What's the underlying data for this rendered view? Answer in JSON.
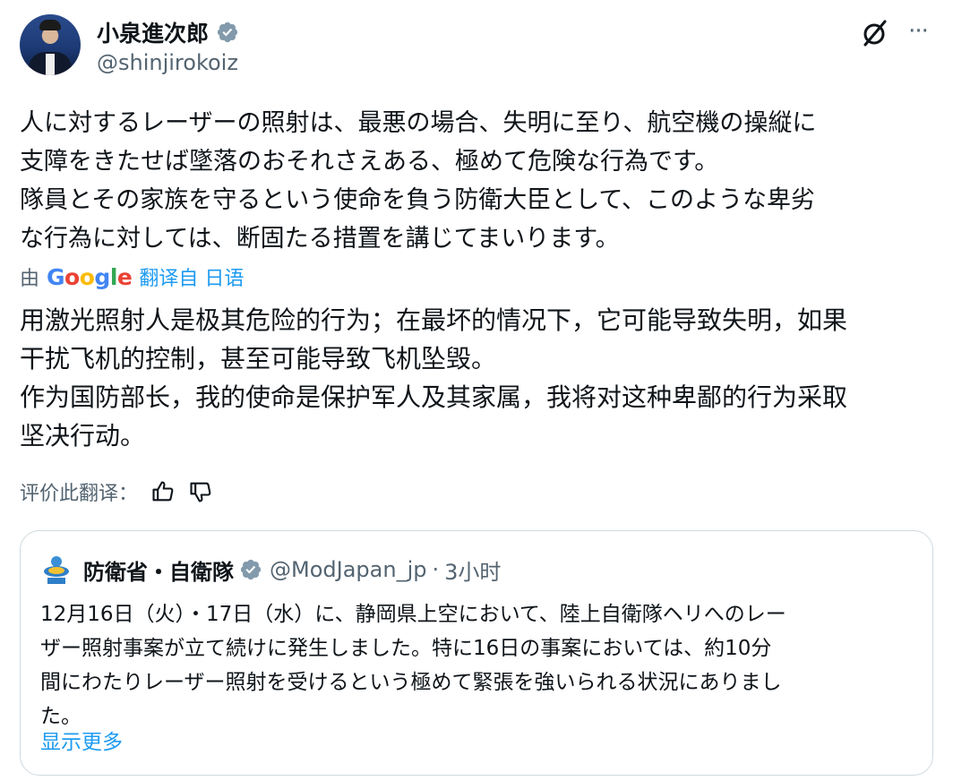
{
  "author": {
    "display_name": "小泉進次郎",
    "handle": "@shinjirokoiz",
    "avatar": "avatar-portrait",
    "verified_icon": "verified-badge-icon"
  },
  "header_actions": {
    "grok_icon": "grok-slash-icon",
    "more_label": "···"
  },
  "post": {
    "original_lines": [
      "人に対するレーザーの照射は、最悪の場合、失明に至り、航空機の操縦に",
      "支障をきたせば墜落のおそれさえある、極めて危険な行為です。",
      "隊員とその家族を守るという使命を負う防衛大臣として、このような卑劣",
      "な行為に対しては、断固たる措置を講じてまいります。"
    ],
    "translated_by_prefix": "由",
    "google_logo_text": "Google",
    "translated_from": "翻译自 日语",
    "translation_lines": [
      "用激光照射人是极其危险的行为；在最坏的情况下，它可能导致失明，如果",
      "干扰飞机的控制，甚至可能导致飞机坠毁。",
      "作为国防部长，我的使命是保护军人及其家属，我将对这种卑鄙的行为采取",
      "坚决行动。"
    ],
    "rate_label": "评价此翻译：",
    "thumbs_up_icon": "thumbs-up-icon",
    "thumbs_down_icon": "thumbs-down-icon"
  },
  "quote": {
    "display_name": "防衛省・自衛隊",
    "handle": "@ModJapan_jp",
    "separator": "·",
    "time": "3小时",
    "body_lines": [
      "12月16日（火）・17日（水）に、静岡県上空において、陸上自衛隊ヘリへのレー",
      "ザー照射事案が立て続けに発生しました。特に16日の事案においては、約10分",
      "間にわたりレーザー照射を受けるという極めて緊張を強いられる状況にありまし",
      "た。"
    ],
    "show_more": "显示更多",
    "logo": "mod-japan-logo-icon"
  },
  "colors": {
    "text": "#0f1419",
    "secondary": "#536471",
    "link": "#1d9bf0",
    "border": "#cfd9de"
  }
}
